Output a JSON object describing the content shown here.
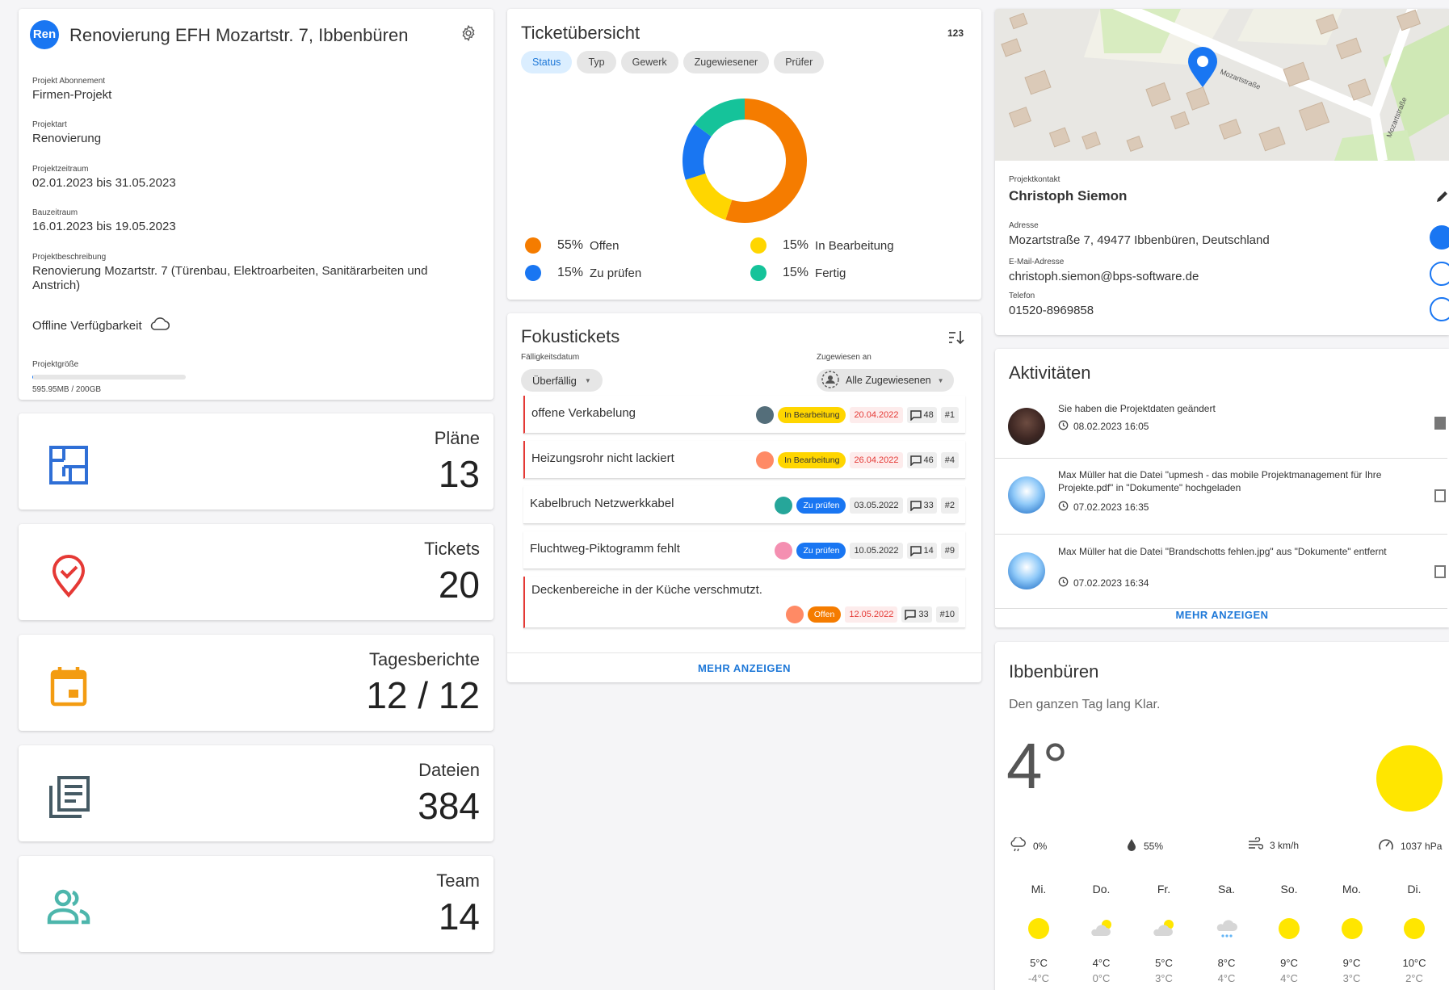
{
  "project": {
    "avatar": "Ren",
    "title": "Renovierung EFH Mozartstr. 7, Ibbenbüren",
    "fields": [
      {
        "label": "Projekt Abonnement",
        "value": "Firmen-Projekt"
      },
      {
        "label": "Projektart",
        "value": "Renovierung"
      },
      {
        "label": "Projektzeitraum",
        "value": "02.01.2023 bis 31.05.2023"
      },
      {
        "label": "Bauzeitraum",
        "value": "16.01.2023 bis 19.05.2023"
      },
      {
        "label": "Projektbeschreibung",
        "value": "Renovierung Mozartstr. 7 (Türenbau, Elektroarbeiten, Sanitärarbeiten und Anstrich)"
      }
    ],
    "offline": "Offline Verfügbarkeit",
    "size_label": "Projektgröße",
    "size_value": "595.95MB / 200GB",
    "size_fraction": 0.003
  },
  "stats": [
    {
      "title": "Pläne",
      "value": "13",
      "icon": "floorplan-icon",
      "color": "#2f6fd6"
    },
    {
      "title": "Tickets",
      "value": "20",
      "icon": "location-check-icon",
      "color": "#e53935"
    },
    {
      "title": "Tagesberichte",
      "value": "12 / 12",
      "icon": "calendar-icon",
      "color": "#f39c12"
    },
    {
      "title": "Dateien",
      "value": "384",
      "icon": "documents-icon",
      "color": "#455a64"
    },
    {
      "title": "Team",
      "value": "14",
      "icon": "team-icon",
      "color": "#4db6ac"
    }
  ],
  "overview": {
    "title": "Ticketübersicht",
    "count": "123",
    "chips": [
      "Status",
      "Typ",
      "Gewerk",
      "Zugewiesener",
      "Prüfer"
    ],
    "chart_data": {
      "type": "pie",
      "categories": [
        "Offen",
        "In Bearbeitung",
        "Zu prüfen",
        "Fertig"
      ],
      "values": [
        55,
        15,
        15,
        15
      ],
      "pct_labels": [
        "55%",
        "15%",
        "15%",
        "15%"
      ],
      "colors": [
        "#f57c00",
        "#ffd600",
        "#1976f2",
        "#15c39a"
      ]
    }
  },
  "focus": {
    "title": "Fokustickets",
    "due_label": "Fälligkeitsdatum",
    "due_value": "Überfällig",
    "assigned_label": "Zugewiesen an",
    "assigned_value": "Alle Zugewiesenen",
    "more": "MEHR ANZEIGEN",
    "tickets": [
      {
        "title": "offene Verkabelung",
        "status": "In Bearbeitung",
        "status_bg": "#ffd600",
        "status_fg": "#333",
        "date": "20.04.2022",
        "date_red": true,
        "comments": "48",
        "num": "#1",
        "flag": true
      },
      {
        "title": "Heizungsrohr nicht lackiert",
        "status": "In Bearbeitung",
        "status_bg": "#ffd600",
        "status_fg": "#333",
        "date": "26.04.2022",
        "date_red": true,
        "comments": "46",
        "num": "#4",
        "flag": true
      },
      {
        "title": "Kabelbruch Netzwerkkabel",
        "status": "Zu prüfen",
        "status_bg": "#1976f2",
        "status_fg": "#fff",
        "date": "03.05.2022",
        "date_red": false,
        "comments": "33",
        "num": "#2",
        "flag": false
      },
      {
        "title": "Fluchtweg-Piktogramm fehlt",
        "status": "Zu prüfen",
        "status_bg": "#1976f2",
        "status_fg": "#fff",
        "date": "10.05.2022",
        "date_red": false,
        "comments": "14",
        "num": "#9",
        "flag": false
      },
      {
        "title": "Deckenbereiche in der Küche verschmutzt.",
        "status": "Offen",
        "status_bg": "#f57c00",
        "status_fg": "#fff",
        "date": "12.05.2022",
        "date_red": true,
        "comments": "33",
        "num": "#10",
        "flag": true
      }
    ]
  },
  "contact": {
    "map_street1": "Mozartstraße",
    "map_street2": "Mozartstraße",
    "label": "Projektkontakt",
    "name": "Christoph Siemon",
    "address_label": "Adresse",
    "address": "Mozartstraße 7, 49477 Ibbenbüren, Deutschland",
    "email_label": "E-Mail-Adresse",
    "email": "christoph.siemon@bps-software.de",
    "phone_label": "Telefon",
    "phone": "01520-8969858"
  },
  "activities": {
    "title": "Aktivitäten",
    "more": "MEHR ANZEIGEN",
    "items": [
      {
        "text": "Sie haben die Projektdaten geändert",
        "time": "08.02.2023 16:05"
      },
      {
        "text": "Max Müller hat die Datei \"upmesh - das mobile Projektmanagement für Ihre Projekte.pdf\" in \"Dokumente\" hochgeladen",
        "time": "07.02.2023 16:35"
      },
      {
        "text": "Max Müller hat die Datei \"Brandschotts fehlen.jpg\" aus \"Dokumente\" entfernt",
        "time": "07.02.2023 16:34"
      }
    ]
  },
  "weather": {
    "city": "Ibbenbüren",
    "summary": "Den ganzen Tag lang Klar.",
    "temp": "4°",
    "rain": "0%",
    "humidity": "55%",
    "wind": "3 km/h",
    "pressure": "1037 hPa",
    "days": [
      {
        "day": "Mi.",
        "icon": "sun",
        "hi": "5°C",
        "lo": "-4°C"
      },
      {
        "day": "Do.",
        "icon": "cloud-sun",
        "hi": "4°C",
        "lo": "0°C"
      },
      {
        "day": "Fr.",
        "icon": "cloud-sun",
        "hi": "5°C",
        "lo": "3°C"
      },
      {
        "day": "Sa.",
        "icon": "cloud-rain",
        "hi": "8°C",
        "lo": "4°C"
      },
      {
        "day": "So.",
        "icon": "sun",
        "hi": "9°C",
        "lo": "4°C"
      },
      {
        "day": "Mo.",
        "icon": "sun",
        "hi": "9°C",
        "lo": "3°C"
      },
      {
        "day": "Di.",
        "icon": "sun",
        "hi": "10°C",
        "lo": "2°C"
      }
    ]
  }
}
